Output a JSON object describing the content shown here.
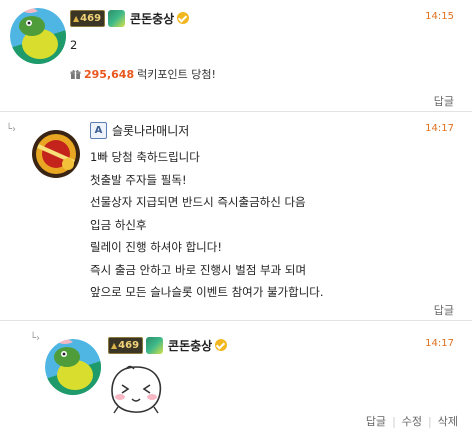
{
  "comments": [
    {
      "level": "469",
      "nickname": "콘돈충상",
      "time": "14:15",
      "text": "2",
      "points_value": "295,648",
      "points_label": "럭키포인트 당첨!",
      "actions": [
        "답글"
      ]
    },
    {
      "nickname": "슬롯나라매니저",
      "time": "14:17",
      "lines": [
        "1빠 당첨 축하드립니다",
        "첫출발 주자들 필독!",
        "선물상자 지급되면 반드시 즉시출금하신 다음",
        "입금 하신후",
        "릴레이 진행 하셔야 합니다!",
        "즉시 출금 안하고 바로 진행시 벌점 부과 되며",
        "앞으로 모든 슬나슬롯 이벤트 참여가 불가합니다."
      ],
      "actions": [
        "답글"
      ]
    },
    {
      "level": "469",
      "nickname": "콘돈충상",
      "time": "14:17",
      "actions": [
        "답글",
        "수정",
        "삭제"
      ]
    }
  ],
  "icons": {
    "reply_arrow": "reply-arrow-icon",
    "points": "gift-icon",
    "verified": "verified-badge-icon",
    "admin": "admin-icon",
    "admin_letter": "A"
  },
  "colors": {
    "time": "#e07020",
    "points": "#e8571e",
    "badge": "#f2b61f"
  }
}
